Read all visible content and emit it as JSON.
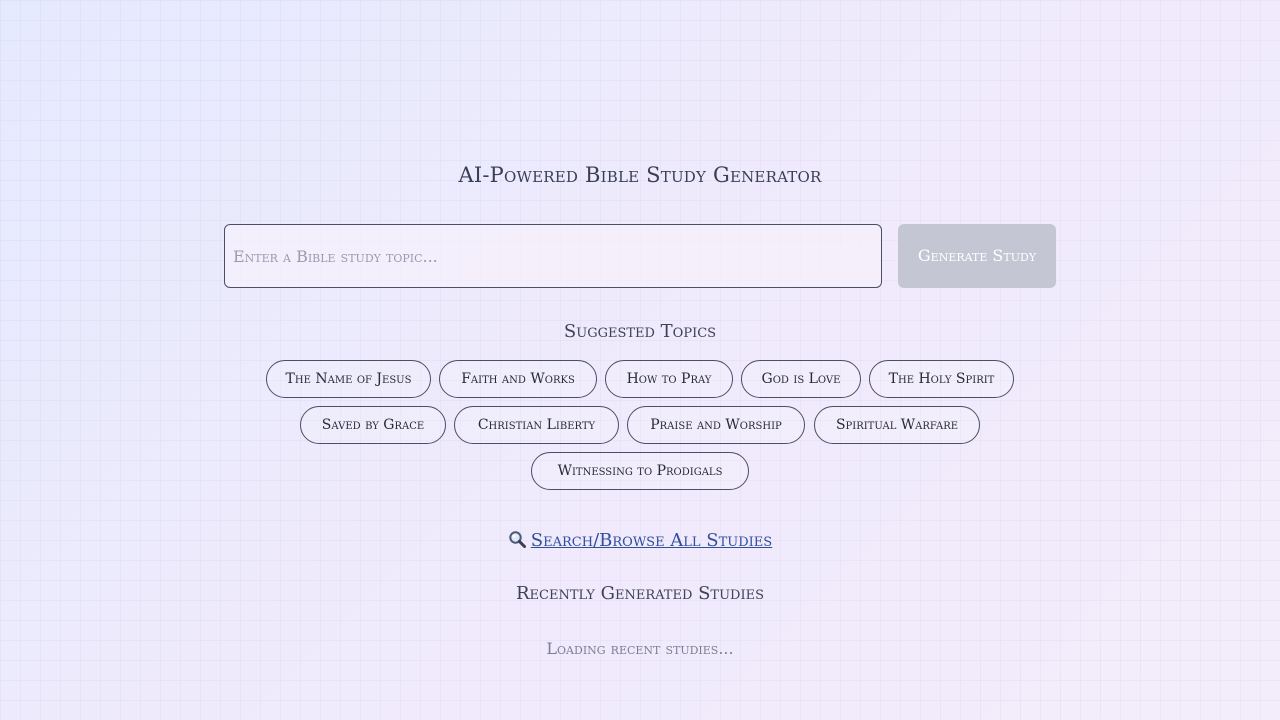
{
  "header": {
    "title": "AI-Powered Bible Study Generator"
  },
  "search": {
    "placeholder": "Enter a Bible study topic...",
    "value": "",
    "generate_label": "Generate Study"
  },
  "suggested": {
    "heading": "Suggested Topics",
    "topics": [
      "The Name of Jesus",
      "Faith and Works",
      "How to Pray",
      "God is Love",
      "The Holy Spirit",
      "Saved by Grace",
      "Christian Liberty",
      "Praise and Worship",
      "Spiritual Warfare",
      "Witnessing to Prodigals"
    ]
  },
  "browse": {
    "icon": "search-icon",
    "label": "Search/Browse All Studies"
  },
  "recent": {
    "heading": "Recently Generated Studies",
    "status": "Loading recent studies..."
  },
  "colors": {
    "link": "#2f4f9c",
    "button_disabled": "#c4c6d3",
    "border": "#4b4f66"
  }
}
